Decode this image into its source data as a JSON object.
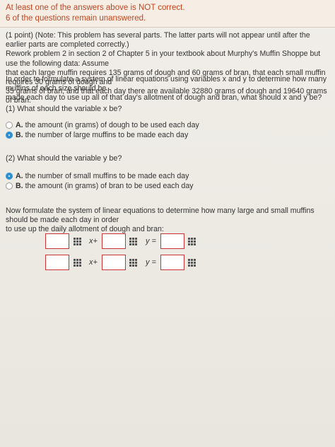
{
  "alert": {
    "line1": "At least one of the answers above is NOT correct.",
    "line2": "6 of the questions remain unanswered."
  },
  "intro": {
    "lines": [
      "(1 point) (Note: This problem has several parts. The latter parts will not appear until after the earlier parts are completed correctly.)",
      "Rework problem 2 in section 2 of Chapter 5 in your textbook about Murphy's Muffin Shoppe but use the following data: Assume",
      "that each large muffin requires 135 grams of dough and 60 grams of bran, that each small muffin requires 30 grams of dough and",
      "35 grams of bran, and that each day there are available 32880 grams of dough and 19640 grams of bran."
    ]
  },
  "formulate": {
    "lines": [
      "In order to formulate a system of linear equations using variables x and y to determine how many muffins of each size should be",
      "made each day to use up all of that day's allotment of dough and bran, what should x and y be?"
    ]
  },
  "q1": {
    "title": "(1) What should the variable x be?",
    "options": [
      {
        "letter": "A.",
        "text": "the amount (in grams) of dough to be used each day",
        "selected": false
      },
      {
        "letter": "B.",
        "text": "the number of large muffins to be made each day",
        "selected": true
      }
    ]
  },
  "q2": {
    "title": "(2) What should the variable y be?",
    "options": [
      {
        "letter": "A.",
        "text": "the number of small muffins to be made each day",
        "selected": true
      },
      {
        "letter": "B.",
        "text": "the amount (in grams) of bran to be used each day",
        "selected": false
      }
    ]
  },
  "system": {
    "lines": [
      "Now formulate the system of linear equations to determine how many large and small muffins should be made each day in order",
      "to use up the daily allotment of dough and bran:"
    ],
    "x_plus": "x+",
    "y_equals": "y ="
  },
  "colors": {
    "error": "#c0451f",
    "selected": "#2f8fd0",
    "box_border": "#cc3333"
  }
}
